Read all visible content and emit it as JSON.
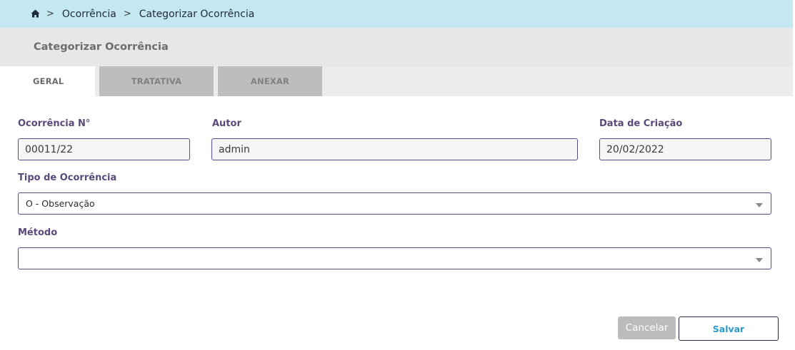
{
  "breadcrumb": {
    "home_icon": "home-icon",
    "separator": ">",
    "items": [
      "Ocorrência",
      "Categorizar Ocorrência"
    ]
  },
  "header": {
    "title": "Categorizar Ocorrência"
  },
  "tabs": [
    {
      "label": "GERAL",
      "active": true
    },
    {
      "label": "TRATATIVA",
      "active": false
    },
    {
      "label": "ANEXAR",
      "active": false
    }
  ],
  "form": {
    "ocorrencia_numero": {
      "label": "Ocorrência N°",
      "value": "00011/22"
    },
    "autor": {
      "label": "Autor",
      "value": "admin"
    },
    "data_criacao": {
      "label": "Data de Criação",
      "value": "20/02/2022"
    },
    "tipo_ocorrencia": {
      "label": "Tipo de Ocorrência",
      "value": "O - Observação"
    },
    "metodo": {
      "label": "Método",
      "value": ""
    }
  },
  "actions": {
    "cancel_label": "Cancelar",
    "save_label": "Salvar"
  },
  "colors": {
    "breadcrumb_bg": "#c3e8f1",
    "label_color": "#5a4a7a",
    "save_text": "#2a9ac8",
    "cancel_bg": "#bcbcbc"
  }
}
